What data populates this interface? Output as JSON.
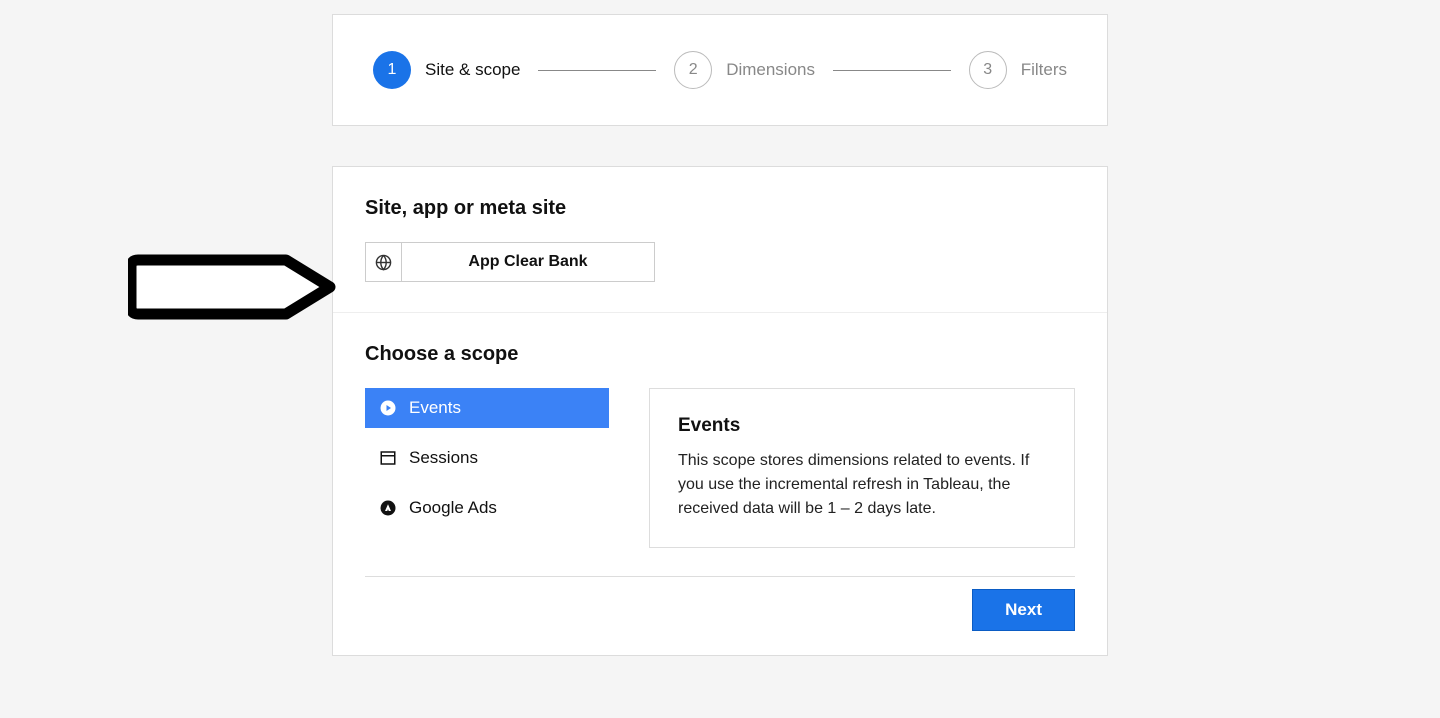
{
  "stepper": {
    "steps": [
      {
        "num": "1",
        "label": "Site & scope",
        "active": true
      },
      {
        "num": "2",
        "label": "Dimensions",
        "active": false
      },
      {
        "num": "3",
        "label": "Filters",
        "active": false
      }
    ]
  },
  "siteSection": {
    "title": "Site, app or meta site",
    "selectedValue": "App Clear Bank"
  },
  "scopeSection": {
    "title": "Choose a scope",
    "items": [
      {
        "label": "Events",
        "active": true,
        "icon": "play"
      },
      {
        "label": "Sessions",
        "active": false,
        "icon": "window"
      },
      {
        "label": "Google Ads",
        "active": false,
        "icon": "ads"
      }
    ],
    "description": {
      "title": "Events",
      "text": "This scope stores dimensions related to events. If you use the incremental refresh in Tableau, the received data will be 1 – 2 days late."
    }
  },
  "footer": {
    "nextLabel": "Next"
  }
}
